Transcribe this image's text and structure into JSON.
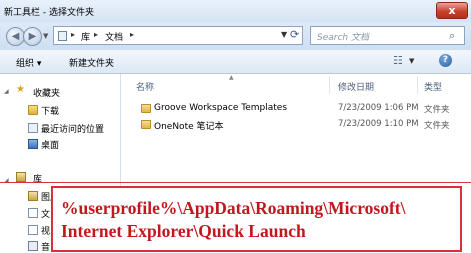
{
  "window": {
    "title": "新工具栏 - 选择文件夹",
    "close_glyph": "x"
  },
  "address": {
    "crumbs": [
      "库",
      "文档"
    ],
    "separator": "▸",
    "search_placeholder": "Search 文档"
  },
  "toolbar": {
    "organize_label": "组织 ▾",
    "new_folder_label": "新建文件夹"
  },
  "nav": {
    "items": [
      {
        "label": "收藏夹",
        "icon": "star-icon"
      },
      {
        "label": "下载",
        "icon": "download-folder-icon"
      },
      {
        "label": "最近访问的位置",
        "icon": "recent-places-icon"
      },
      {
        "label": "桌面",
        "icon": "desktop-icon"
      },
      {
        "label": "库",
        "icon": "library-icon"
      },
      {
        "label": "图片",
        "icon": "pictures-icon"
      },
      {
        "label": "文",
        "icon": "documents-icon"
      },
      {
        "label": "视",
        "icon": "videos-icon"
      },
      {
        "label": "音",
        "icon": "music-icon"
      }
    ]
  },
  "columns": {
    "name": "名称",
    "date": "修改日期",
    "type": "类型"
  },
  "files": [
    {
      "name": "Groove Workspace Templates",
      "date": "7/23/2009 1:06 PM",
      "type": "文件夹"
    },
    {
      "name": "OneNote 笔记本",
      "date": "7/23/2009 1:10 PM",
      "type": "文件夹"
    }
  ],
  "callout": {
    "line1": "%userprofile%\\AppData\\Roaming\\Microsoft\\",
    "line2": "Internet Explorer\\Quick Launch",
    "color": "#c0181e",
    "border_color": "#d8303c"
  }
}
